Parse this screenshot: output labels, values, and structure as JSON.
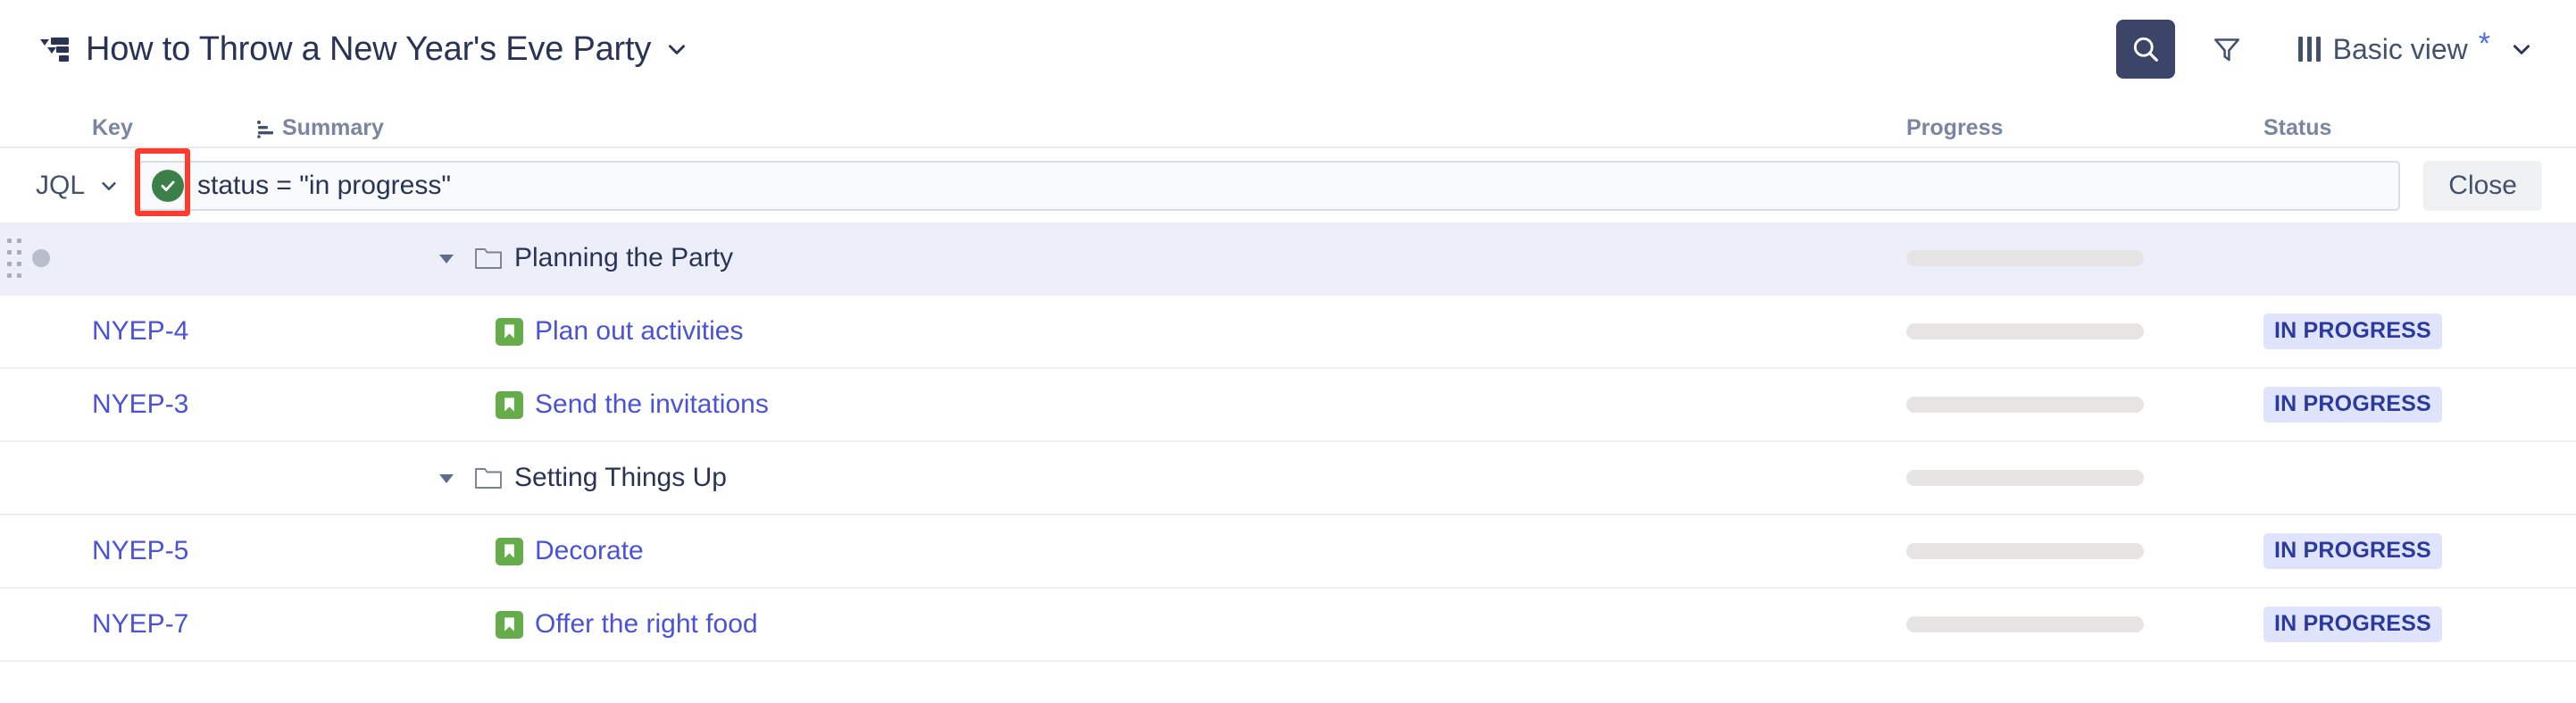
{
  "header": {
    "structure_icon": "structure-hierarchy-icon",
    "title": "How to Throw a New Year's Eve Party",
    "title_caret": "chevron-down-icon",
    "search_icon": "search-icon",
    "filter_icon": "filter-funnel-icon",
    "view_columns_icon": "columns-icon",
    "view_name": "Basic view",
    "view_modified_marker": "*",
    "view_caret": "chevron-down-icon"
  },
  "columns": {
    "key": "Key",
    "summary": "Summary",
    "summary_icon": "hierarchy-icon",
    "progress": "Progress",
    "status": "Status"
  },
  "jql": {
    "label": "JQL",
    "label_caret": "chevron-down-icon",
    "valid_icon": "check-circle-icon",
    "valid_highlight_color": "#ff3b30",
    "query": "status = \"in progress\"",
    "placeholder": "",
    "close_label": "Close"
  },
  "colors": {
    "accent_link": "#4a52d6",
    "selected_row": "#eceffa",
    "status_badge_bg": "#dfe4fc",
    "status_badge_fg": "#2b3a9e",
    "story_icon_green": "#67ac4b",
    "valid_green": "#3c8049",
    "search_btn_bg": "#3c4568"
  },
  "rows": [
    {
      "kind": "folder",
      "selected": true,
      "has_gutter": true,
      "gutter_icon": "drag-handle-icon",
      "dot": true,
      "key": "",
      "indent": "lvl1",
      "twisty": "caret-down-icon",
      "icon": "folder-icon",
      "summary": "Planning the Party",
      "progress": true,
      "status": ""
    },
    {
      "kind": "issue",
      "selected": false,
      "has_gutter": false,
      "dot": false,
      "key": "NYEP-4",
      "indent": "lvl2",
      "twisty": "",
      "icon": "story-icon",
      "summary": "Plan out activities",
      "progress": true,
      "status": "IN PROGRESS"
    },
    {
      "kind": "issue",
      "selected": false,
      "has_gutter": false,
      "dot": false,
      "key": "NYEP-3",
      "indent": "lvl2",
      "twisty": "",
      "icon": "story-icon",
      "summary": "Send the invitations",
      "progress": true,
      "status": "IN PROGRESS"
    },
    {
      "kind": "folder",
      "selected": false,
      "has_gutter": false,
      "dot": false,
      "key": "",
      "indent": "lvl1",
      "twisty": "caret-down-icon",
      "icon": "folder-icon",
      "summary": "Setting Things Up",
      "progress": true,
      "status": ""
    },
    {
      "kind": "issue",
      "selected": false,
      "has_gutter": false,
      "dot": false,
      "key": "NYEP-5",
      "indent": "lvl2",
      "twisty": "",
      "icon": "story-icon",
      "summary": "Decorate",
      "progress": true,
      "status": "IN PROGRESS"
    },
    {
      "kind": "issue",
      "selected": false,
      "has_gutter": false,
      "dot": false,
      "key": "NYEP-7",
      "indent": "lvl2",
      "twisty": "",
      "icon": "story-icon",
      "summary": "Offer the right food",
      "progress": true,
      "status": "IN PROGRESS"
    }
  ]
}
